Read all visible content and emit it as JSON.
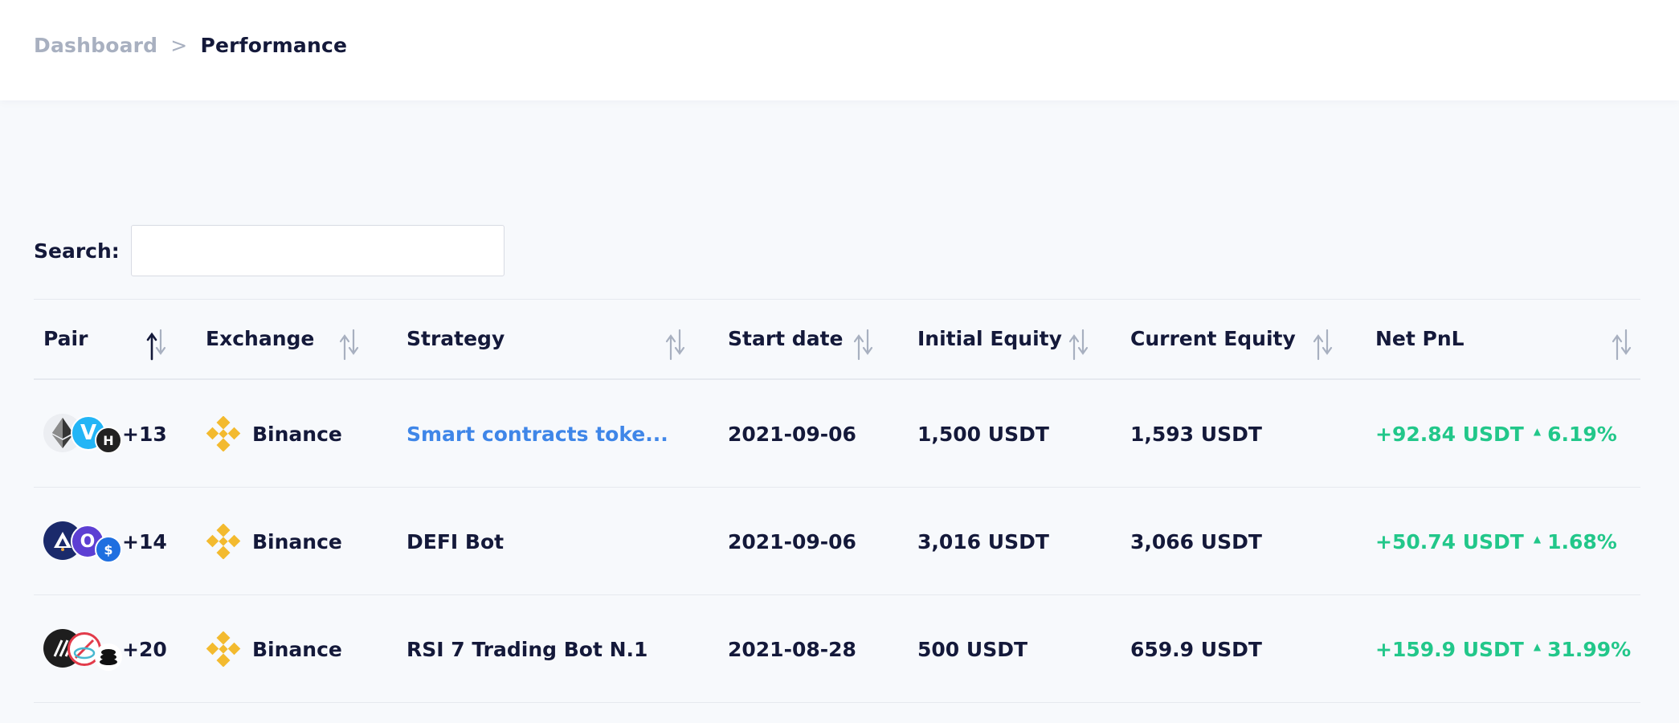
{
  "breadcrumb": {
    "root": "Dashboard",
    "separator": ">",
    "current": "Performance"
  },
  "search": {
    "label": "Search:",
    "value": "",
    "placeholder": ""
  },
  "table": {
    "columns": {
      "pair": "Pair",
      "exchange": "Exchange",
      "strategy": "Strategy",
      "start_date": "Start date",
      "initial_equity": "Initial Equity",
      "current_equity": "Current Equity",
      "net_pnl": "Net PnL"
    },
    "active_sort": "pair-ascending",
    "rows": [
      {
        "pair_icons": [
          "ethereum-icon",
          "vechain-icon",
          "hedera-icon"
        ],
        "pair_more": "+13",
        "exchange": "Binance",
        "exchange_icon": "binance-icon",
        "strategy": "Smart contracts toke...",
        "strategy_is_link": true,
        "start_date": "2021-09-06",
        "initial_equity": "1,500 USDT",
        "current_equity": "1,593 USDT",
        "pnl_value": "+92.84 USDT",
        "pnl_percent": "6.19%"
      },
      {
        "pair_icons": [
          "avalanche-icon",
          "ocean-icon",
          "syscoin-icon"
        ],
        "pair_more": "+14",
        "exchange": "Binance",
        "exchange_icon": "binance-icon",
        "strategy": "DEFI Bot",
        "strategy_is_link": false,
        "start_date": "2021-09-06",
        "initial_equity": "3,016 USDT",
        "current_equity": "3,066 USDT",
        "pnl_value": "+50.74 USDT",
        "pnl_percent": "1.68%"
      },
      {
        "pair_icons": [
          "near-icon",
          "celer-icon",
          "stack-icon"
        ],
        "pair_more": "+20",
        "exchange": "Binance",
        "exchange_icon": "binance-icon",
        "strategy": "RSI 7 Trading Bot N.1",
        "strategy_is_link": false,
        "start_date": "2021-08-28",
        "initial_equity": "500 USDT",
        "current_equity": "659.9 USDT",
        "pnl_value": "+159.9 USDT",
        "pnl_percent": "31.99%"
      }
    ]
  },
  "colors": {
    "background": "#f7f9fc",
    "text_primary": "#14193a",
    "text_muted": "#a8b0c0",
    "link": "#3f86e8",
    "positive": "#22c78a",
    "binance": "#f3ba2f",
    "sort_inactive": "#a8b0c0",
    "sort_active": "#14193a"
  }
}
